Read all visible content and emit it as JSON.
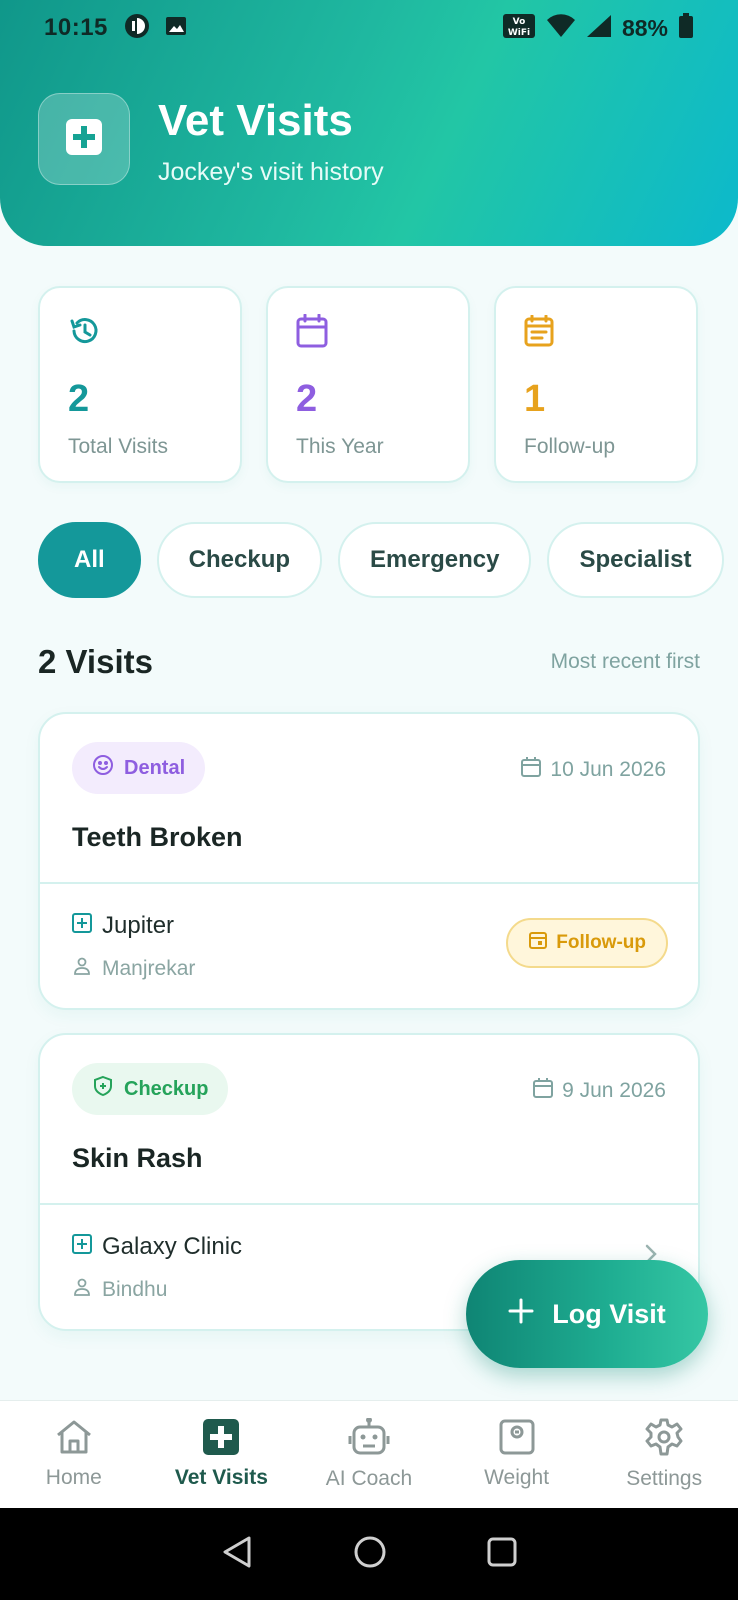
{
  "status_bar": {
    "time": "10:15",
    "battery_percent": "88%"
  },
  "header": {
    "title": "Vet Visits",
    "subtitle": "Jockey's visit history",
    "icon": "medical-plus-icon"
  },
  "stats": [
    {
      "value": "2",
      "label": "Total Visits",
      "icon": "history-icon",
      "color": "#14989a"
    },
    {
      "value": "2",
      "label": "This Year",
      "icon": "calendar-icon",
      "color": "#8e5ee0"
    },
    {
      "value": "1",
      "label": "Follow-up",
      "icon": "event-note-icon",
      "color": "#e7a21d"
    }
  ],
  "filters": {
    "items": [
      "All",
      "Checkup",
      "Emergency",
      "Specialist"
    ],
    "selected": "All"
  },
  "list": {
    "title": "2 Visits",
    "sort_label": "Most recent first"
  },
  "visits": [
    {
      "type": "Dental",
      "type_icon": "smile-icon",
      "type_color": "#8e5ee0",
      "type_bg": "#f3ecfd",
      "date": "10 Jun 2026",
      "title": "Teeth Broken",
      "clinic": "Jupiter",
      "vet": "Manjrekar",
      "followup_label": "Follow-up"
    },
    {
      "type": "Checkup",
      "type_icon": "shield-plus-icon",
      "type_color": "#25a35a",
      "type_bg": "#e9f8ef",
      "date": "9 Jun 2026",
      "title": "Skin Rash",
      "clinic": "Galaxy Clinic",
      "vet": "Bindhu"
    }
  ],
  "fab": {
    "label": "Log Visit"
  },
  "bottom_nav": {
    "items": [
      {
        "label": "Home",
        "icon": "home-icon"
      },
      {
        "label": "Vet Visits",
        "icon": "medical-plus-icon"
      },
      {
        "label": "AI Coach",
        "icon": "robot-icon"
      },
      {
        "label": "Weight",
        "icon": "scale-icon"
      },
      {
        "label": "Settings",
        "icon": "gear-icon"
      }
    ],
    "active": "Vet Visits"
  }
}
